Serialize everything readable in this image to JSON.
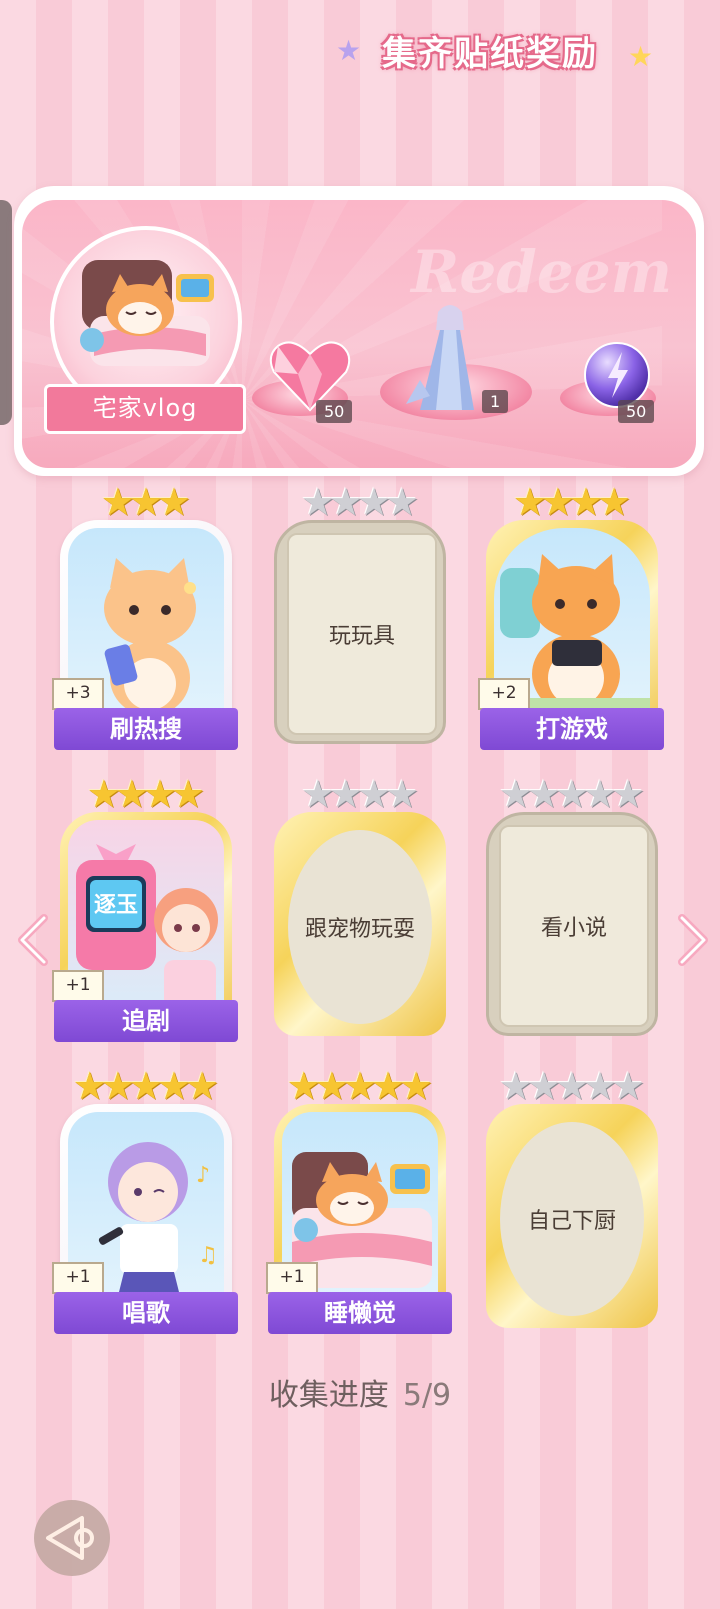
{
  "banner": {
    "title": "集齐贴纸奖励",
    "watermark": "Redeem",
    "theme_label": "宅家vlog",
    "rewards": [
      {
        "icon": "pink-heart-gem-icon",
        "count": "50"
      },
      {
        "icon": "doll-costume-icon",
        "count": "1"
      },
      {
        "icon": "purple-energy-orb-icon",
        "count": "50"
      }
    ]
  },
  "cards": [
    {
      "label": "刷热搜",
      "stars": 3,
      "bonus": "+3",
      "collected": true,
      "frame": "white"
    },
    {
      "label": "玩玩具",
      "stars": 4,
      "bonus": "",
      "collected": false,
      "frame": "beige"
    },
    {
      "label": "打游戏",
      "stars": 4,
      "bonus": "+2",
      "collected": true,
      "frame": "gold"
    },
    {
      "label": "追剧",
      "stars": 4,
      "bonus": "+1",
      "collected": true,
      "frame": "gold"
    },
    {
      "label": "跟宠物玩耍",
      "stars": 4,
      "bonus": "",
      "collected": false,
      "frame": "gold"
    },
    {
      "label": "看小说",
      "stars": 5,
      "bonus": "",
      "collected": false,
      "frame": "beige"
    },
    {
      "label": "唱歌",
      "stars": 5,
      "bonus": "+1",
      "collected": true,
      "frame": "white"
    },
    {
      "label": "睡懒觉",
      "stars": 5,
      "bonus": "+1",
      "collected": true,
      "frame": "gold"
    },
    {
      "label": "自己下厨",
      "stars": 5,
      "bonus": "",
      "collected": false,
      "frame": "gold"
    }
  ],
  "tv_screen_text": "逐玉",
  "progress": {
    "label": "收集进度",
    "value": "5/9"
  },
  "colors": {
    "accent_pink": "#f2799b",
    "label_purple": "#8a55dc",
    "gold": "#f7c531"
  }
}
